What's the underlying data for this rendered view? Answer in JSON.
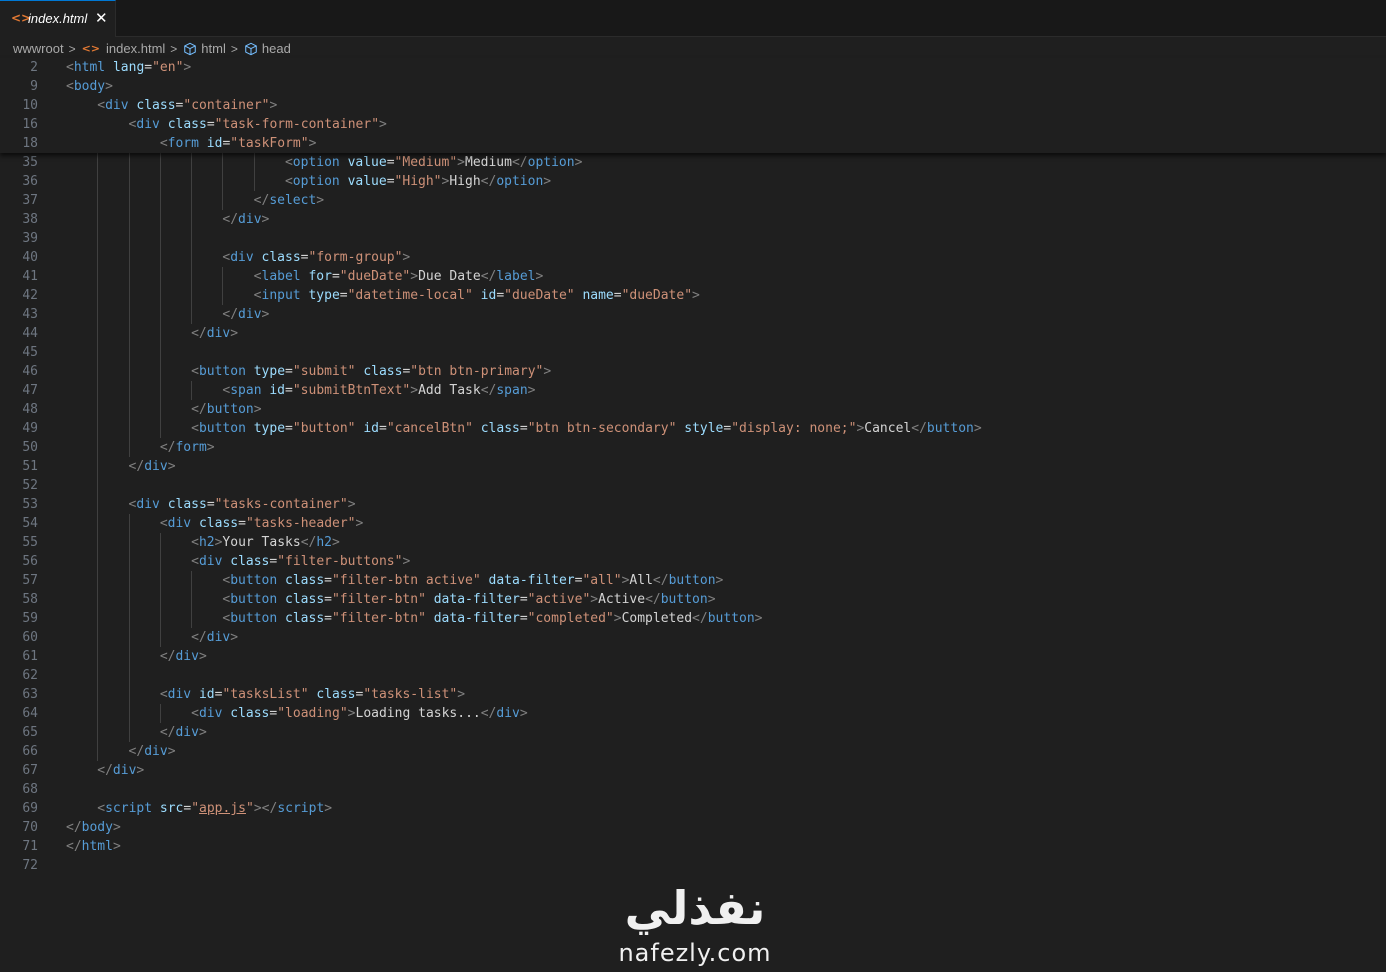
{
  "tab": {
    "label": "index.html",
    "close_glyph": "✕",
    "icon": "html-file-icon"
  },
  "breadcrumb": {
    "root": "wwwroot",
    "file": "index.html",
    "sym1": "html",
    "sym2": "head"
  },
  "sticky_lines": [
    {
      "n": "2",
      "i": 0,
      "t": [
        [
          "p",
          "<"
        ],
        [
          "t",
          "html"
        ],
        [
          "x",
          " "
        ],
        [
          "a",
          "lang"
        ],
        [
          "x",
          "="
        ],
        [
          "s",
          "\"en\""
        ],
        [
          "p",
          ">"
        ]
      ]
    },
    {
      "n": "9",
      "i": 0,
      "t": [
        [
          "p",
          "<"
        ],
        [
          "t",
          "body"
        ],
        [
          "p",
          ">"
        ]
      ]
    },
    {
      "n": "10",
      "i": 1,
      "t": [
        [
          "p",
          "<"
        ],
        [
          "t",
          "div"
        ],
        [
          "x",
          " "
        ],
        [
          "a",
          "class"
        ],
        [
          "x",
          "="
        ],
        [
          "s",
          "\"container\""
        ],
        [
          "p",
          ">"
        ]
      ]
    },
    {
      "n": "16",
      "i": 2,
      "t": [
        [
          "p",
          "<"
        ],
        [
          "t",
          "div"
        ],
        [
          "x",
          " "
        ],
        [
          "a",
          "class"
        ],
        [
          "x",
          "="
        ],
        [
          "s",
          "\"task-form-container\""
        ],
        [
          "p",
          ">"
        ]
      ]
    },
    {
      "n": "18",
      "i": 3,
      "t": [
        [
          "p",
          "<"
        ],
        [
          "t",
          "form"
        ],
        [
          "x",
          " "
        ],
        [
          "a",
          "id"
        ],
        [
          "x",
          "="
        ],
        [
          "s",
          "\"taskForm\""
        ],
        [
          "p",
          ">"
        ]
      ]
    }
  ],
  "code_lines": [
    {
      "n": "35",
      "i": 7,
      "g": [
        1,
        2,
        3,
        4,
        5,
        6
      ],
      "t": [
        [
          "p",
          "<"
        ],
        [
          "t",
          "option"
        ],
        [
          "x",
          " "
        ],
        [
          "a",
          "value"
        ],
        [
          "x",
          "="
        ],
        [
          "s",
          "\"Medium\""
        ],
        [
          "p",
          ">"
        ],
        [
          "x",
          "Medium"
        ],
        [
          "p",
          "</"
        ],
        [
          "t",
          "option"
        ],
        [
          "p",
          ">"
        ]
      ]
    },
    {
      "n": "36",
      "i": 7,
      "g": [
        1,
        2,
        3,
        4,
        5,
        6
      ],
      "t": [
        [
          "p",
          "<"
        ],
        [
          "t",
          "option"
        ],
        [
          "x",
          " "
        ],
        [
          "a",
          "value"
        ],
        [
          "x",
          "="
        ],
        [
          "s",
          "\"High\""
        ],
        [
          "p",
          ">"
        ],
        [
          "x",
          "High"
        ],
        [
          "p",
          "</"
        ],
        [
          "t",
          "option"
        ],
        [
          "p",
          ">"
        ]
      ]
    },
    {
      "n": "37",
      "i": 6,
      "g": [
        1,
        2,
        3,
        4,
        5
      ],
      "t": [
        [
          "p",
          "</"
        ],
        [
          "t",
          "select"
        ],
        [
          "p",
          ">"
        ]
      ]
    },
    {
      "n": "38",
      "i": 5,
      "g": [
        1,
        2,
        3,
        4
      ],
      "t": [
        [
          "p",
          "</"
        ],
        [
          "t",
          "div"
        ],
        [
          "p",
          ">"
        ]
      ]
    },
    {
      "n": "39",
      "i": 0,
      "g": [
        1,
        2,
        3,
        4
      ],
      "t": []
    },
    {
      "n": "40",
      "i": 5,
      "g": [
        1,
        2,
        3,
        4
      ],
      "t": [
        [
          "p",
          "<"
        ],
        [
          "t",
          "div"
        ],
        [
          "x",
          " "
        ],
        [
          "a",
          "class"
        ],
        [
          "x",
          "="
        ],
        [
          "s",
          "\"form-group\""
        ],
        [
          "p",
          ">"
        ]
      ]
    },
    {
      "n": "41",
      "i": 6,
      "g": [
        1,
        2,
        3,
        4,
        5
      ],
      "t": [
        [
          "p",
          "<"
        ],
        [
          "t",
          "label"
        ],
        [
          "x",
          " "
        ],
        [
          "a",
          "for"
        ],
        [
          "x",
          "="
        ],
        [
          "s",
          "\"dueDate\""
        ],
        [
          "p",
          ">"
        ],
        [
          "x",
          "Due Date"
        ],
        [
          "p",
          "</"
        ],
        [
          "t",
          "label"
        ],
        [
          "p",
          ">"
        ]
      ]
    },
    {
      "n": "42",
      "i": 6,
      "g": [
        1,
        2,
        3,
        4,
        5
      ],
      "t": [
        [
          "p",
          "<"
        ],
        [
          "t",
          "input"
        ],
        [
          "x",
          " "
        ],
        [
          "a",
          "type"
        ],
        [
          "x",
          "="
        ],
        [
          "s",
          "\"datetime-local\""
        ],
        [
          "x",
          " "
        ],
        [
          "a",
          "id"
        ],
        [
          "x",
          "="
        ],
        [
          "s",
          "\"dueDate\""
        ],
        [
          "x",
          " "
        ],
        [
          "a",
          "name"
        ],
        [
          "x",
          "="
        ],
        [
          "s",
          "\"dueDate\""
        ],
        [
          "p",
          ">"
        ]
      ]
    },
    {
      "n": "43",
      "i": 5,
      "g": [
        1,
        2,
        3,
        4
      ],
      "t": [
        [
          "p",
          "</"
        ],
        [
          "t",
          "div"
        ],
        [
          "p",
          ">"
        ]
      ]
    },
    {
      "n": "44",
      "i": 4,
      "g": [
        1,
        2,
        3
      ],
      "t": [
        [
          "p",
          "</"
        ],
        [
          "t",
          "div"
        ],
        [
          "p",
          ">"
        ]
      ]
    },
    {
      "n": "45",
      "i": 0,
      "g": [
        1,
        2,
        3
      ],
      "t": []
    },
    {
      "n": "46",
      "i": 4,
      "g": [
        1,
        2,
        3
      ],
      "t": [
        [
          "p",
          "<"
        ],
        [
          "t",
          "button"
        ],
        [
          "x",
          " "
        ],
        [
          "a",
          "type"
        ],
        [
          "x",
          "="
        ],
        [
          "s",
          "\"submit\""
        ],
        [
          "x",
          " "
        ],
        [
          "a",
          "class"
        ],
        [
          "x",
          "="
        ],
        [
          "s",
          "\"btn btn-primary\""
        ],
        [
          "p",
          ">"
        ]
      ]
    },
    {
      "n": "47",
      "i": 5,
      "g": [
        1,
        2,
        3,
        4
      ],
      "t": [
        [
          "p",
          "<"
        ],
        [
          "t",
          "span"
        ],
        [
          "x",
          " "
        ],
        [
          "a",
          "id"
        ],
        [
          "x",
          "="
        ],
        [
          "s",
          "\"submitBtnText\""
        ],
        [
          "p",
          ">"
        ],
        [
          "x",
          "Add Task"
        ],
        [
          "p",
          "</"
        ],
        [
          "t",
          "span"
        ],
        [
          "p",
          ">"
        ]
      ]
    },
    {
      "n": "48",
      "i": 4,
      "g": [
        1,
        2,
        3
      ],
      "t": [
        [
          "p",
          "</"
        ],
        [
          "t",
          "button"
        ],
        [
          "p",
          ">"
        ]
      ]
    },
    {
      "n": "49",
      "i": 4,
      "g": [
        1,
        2,
        3
      ],
      "t": [
        [
          "p",
          "<"
        ],
        [
          "t",
          "button"
        ],
        [
          "x",
          " "
        ],
        [
          "a",
          "type"
        ],
        [
          "x",
          "="
        ],
        [
          "s",
          "\"button\""
        ],
        [
          "x",
          " "
        ],
        [
          "a",
          "id"
        ],
        [
          "x",
          "="
        ],
        [
          "s",
          "\"cancelBtn\""
        ],
        [
          "x",
          " "
        ],
        [
          "a",
          "class"
        ],
        [
          "x",
          "="
        ],
        [
          "s",
          "\"btn btn-secondary\""
        ],
        [
          "x",
          " "
        ],
        [
          "a",
          "style"
        ],
        [
          "x",
          "="
        ],
        [
          "s",
          "\"display: none;\""
        ],
        [
          "p",
          ">"
        ],
        [
          "x",
          "Cancel"
        ],
        [
          "p",
          "</"
        ],
        [
          "t",
          "button"
        ],
        [
          "p",
          ">"
        ]
      ]
    },
    {
      "n": "50",
      "i": 3,
      "g": [
        1,
        2
      ],
      "t": [
        [
          "p",
          "</"
        ],
        [
          "t",
          "form"
        ],
        [
          "p",
          ">"
        ]
      ]
    },
    {
      "n": "51",
      "i": 2,
      "g": [
        1
      ],
      "t": [
        [
          "p",
          "</"
        ],
        [
          "t",
          "div"
        ],
        [
          "p",
          ">"
        ]
      ]
    },
    {
      "n": "52",
      "i": 0,
      "g": [
        1
      ],
      "t": []
    },
    {
      "n": "53",
      "i": 2,
      "g": [
        1
      ],
      "t": [
        [
          "p",
          "<"
        ],
        [
          "t",
          "div"
        ],
        [
          "x",
          " "
        ],
        [
          "a",
          "class"
        ],
        [
          "x",
          "="
        ],
        [
          "s",
          "\"tasks-container\""
        ],
        [
          "p",
          ">"
        ]
      ]
    },
    {
      "n": "54",
      "i": 3,
      "g": [
        1,
        2
      ],
      "t": [
        [
          "p",
          "<"
        ],
        [
          "t",
          "div"
        ],
        [
          "x",
          " "
        ],
        [
          "a",
          "class"
        ],
        [
          "x",
          "="
        ],
        [
          "s",
          "\"tasks-header\""
        ],
        [
          "p",
          ">"
        ]
      ]
    },
    {
      "n": "55",
      "i": 4,
      "g": [
        1,
        2,
        3
      ],
      "t": [
        [
          "p",
          "<"
        ],
        [
          "t",
          "h2"
        ],
        [
          "p",
          ">"
        ],
        [
          "x",
          "Your Tasks"
        ],
        [
          "p",
          "</"
        ],
        [
          "t",
          "h2"
        ],
        [
          "p",
          ">"
        ]
      ]
    },
    {
      "n": "56",
      "i": 4,
      "g": [
        1,
        2,
        3
      ],
      "t": [
        [
          "p",
          "<"
        ],
        [
          "t",
          "div"
        ],
        [
          "x",
          " "
        ],
        [
          "a",
          "class"
        ],
        [
          "x",
          "="
        ],
        [
          "s",
          "\"filter-buttons\""
        ],
        [
          "p",
          ">"
        ]
      ]
    },
    {
      "n": "57",
      "i": 5,
      "g": [
        1,
        2,
        3,
        4
      ],
      "t": [
        [
          "p",
          "<"
        ],
        [
          "t",
          "button"
        ],
        [
          "x",
          " "
        ],
        [
          "a",
          "class"
        ],
        [
          "x",
          "="
        ],
        [
          "s",
          "\"filter-btn active\""
        ],
        [
          "x",
          " "
        ],
        [
          "a",
          "data-filter"
        ],
        [
          "x",
          "="
        ],
        [
          "s",
          "\"all\""
        ],
        [
          "p",
          ">"
        ],
        [
          "x",
          "All"
        ],
        [
          "p",
          "</"
        ],
        [
          "t",
          "button"
        ],
        [
          "p",
          ">"
        ]
      ]
    },
    {
      "n": "58",
      "i": 5,
      "g": [
        1,
        2,
        3,
        4
      ],
      "t": [
        [
          "p",
          "<"
        ],
        [
          "t",
          "button"
        ],
        [
          "x",
          " "
        ],
        [
          "a",
          "class"
        ],
        [
          "x",
          "="
        ],
        [
          "s",
          "\"filter-btn\""
        ],
        [
          "x",
          " "
        ],
        [
          "a",
          "data-filter"
        ],
        [
          "x",
          "="
        ],
        [
          "s",
          "\"active\""
        ],
        [
          "p",
          ">"
        ],
        [
          "x",
          "Active"
        ],
        [
          "p",
          "</"
        ],
        [
          "t",
          "button"
        ],
        [
          "p",
          ">"
        ]
      ]
    },
    {
      "n": "59",
      "i": 5,
      "g": [
        1,
        2,
        3,
        4
      ],
      "t": [
        [
          "p",
          "<"
        ],
        [
          "t",
          "button"
        ],
        [
          "x",
          " "
        ],
        [
          "a",
          "class"
        ],
        [
          "x",
          "="
        ],
        [
          "s",
          "\"filter-btn\""
        ],
        [
          "x",
          " "
        ],
        [
          "a",
          "data-filter"
        ],
        [
          "x",
          "="
        ],
        [
          "s",
          "\"completed\""
        ],
        [
          "p",
          ">"
        ],
        [
          "x",
          "Completed"
        ],
        [
          "p",
          "</"
        ],
        [
          "t",
          "button"
        ],
        [
          "p",
          ">"
        ]
      ]
    },
    {
      "n": "60",
      "i": 4,
      "g": [
        1,
        2,
        3
      ],
      "t": [
        [
          "p",
          "</"
        ],
        [
          "t",
          "div"
        ],
        [
          "p",
          ">"
        ]
      ]
    },
    {
      "n": "61",
      "i": 3,
      "g": [
        1,
        2
      ],
      "t": [
        [
          "p",
          "</"
        ],
        [
          "t",
          "div"
        ],
        [
          "p",
          ">"
        ]
      ]
    },
    {
      "n": "62",
      "i": 0,
      "g": [
        1,
        2
      ],
      "t": []
    },
    {
      "n": "63",
      "i": 3,
      "g": [
        1,
        2
      ],
      "t": [
        [
          "p",
          "<"
        ],
        [
          "t",
          "div"
        ],
        [
          "x",
          " "
        ],
        [
          "a",
          "id"
        ],
        [
          "x",
          "="
        ],
        [
          "s",
          "\"tasksList\""
        ],
        [
          "x",
          " "
        ],
        [
          "a",
          "class"
        ],
        [
          "x",
          "="
        ],
        [
          "s",
          "\"tasks-list\""
        ],
        [
          "p",
          ">"
        ]
      ]
    },
    {
      "n": "64",
      "i": 4,
      "g": [
        1,
        2,
        3
      ],
      "t": [
        [
          "p",
          "<"
        ],
        [
          "t",
          "div"
        ],
        [
          "x",
          " "
        ],
        [
          "a",
          "class"
        ],
        [
          "x",
          "="
        ],
        [
          "s",
          "\"loading\""
        ],
        [
          "p",
          ">"
        ],
        [
          "x",
          "Loading tasks..."
        ],
        [
          "p",
          "</"
        ],
        [
          "t",
          "div"
        ],
        [
          "p",
          ">"
        ]
      ]
    },
    {
      "n": "65",
      "i": 3,
      "g": [
        1,
        2
      ],
      "t": [
        [
          "p",
          "</"
        ],
        [
          "t",
          "div"
        ],
        [
          "p",
          ">"
        ]
      ]
    },
    {
      "n": "66",
      "i": 2,
      "g": [
        1
      ],
      "t": [
        [
          "p",
          "</"
        ],
        [
          "t",
          "div"
        ],
        [
          "p",
          ">"
        ]
      ]
    },
    {
      "n": "67",
      "i": 1,
      "g": [],
      "t": [
        [
          "p",
          "</"
        ],
        [
          "t",
          "div"
        ],
        [
          "p",
          ">"
        ]
      ]
    },
    {
      "n": "68",
      "i": 0,
      "g": [],
      "t": []
    },
    {
      "n": "69",
      "i": 1,
      "g": [],
      "t": [
        [
          "p",
          "<"
        ],
        [
          "t",
          "script"
        ],
        [
          "x",
          " "
        ],
        [
          "a",
          "src"
        ],
        [
          "x",
          "="
        ],
        [
          "s",
          "\""
        ],
        [
          "su",
          "app.js"
        ],
        [
          "s",
          "\""
        ],
        [
          "p",
          "></"
        ],
        [
          "t",
          "script"
        ],
        [
          "p",
          ">"
        ]
      ]
    },
    {
      "n": "70",
      "i": 0,
      "g": [],
      "t": [
        [
          "p",
          "</"
        ],
        [
          "t",
          "body"
        ],
        [
          "p",
          ">"
        ]
      ]
    },
    {
      "n": "71",
      "i": 0,
      "g": [],
      "t": [
        [
          "p",
          "</"
        ],
        [
          "t",
          "html"
        ],
        [
          "p",
          ">"
        ]
      ]
    },
    {
      "n": "72",
      "i": 0,
      "g": [],
      "t": []
    }
  ],
  "watermark": {
    "arabic": "نفذلي",
    "latin": "nafezly.com"
  },
  "colors": {
    "tag": "#569cd6",
    "attr": "#9cdcfe",
    "string": "#ce9178",
    "text": "#d4d4d4",
    "punct": "#808080",
    "tab_accent": "#0078d4"
  }
}
